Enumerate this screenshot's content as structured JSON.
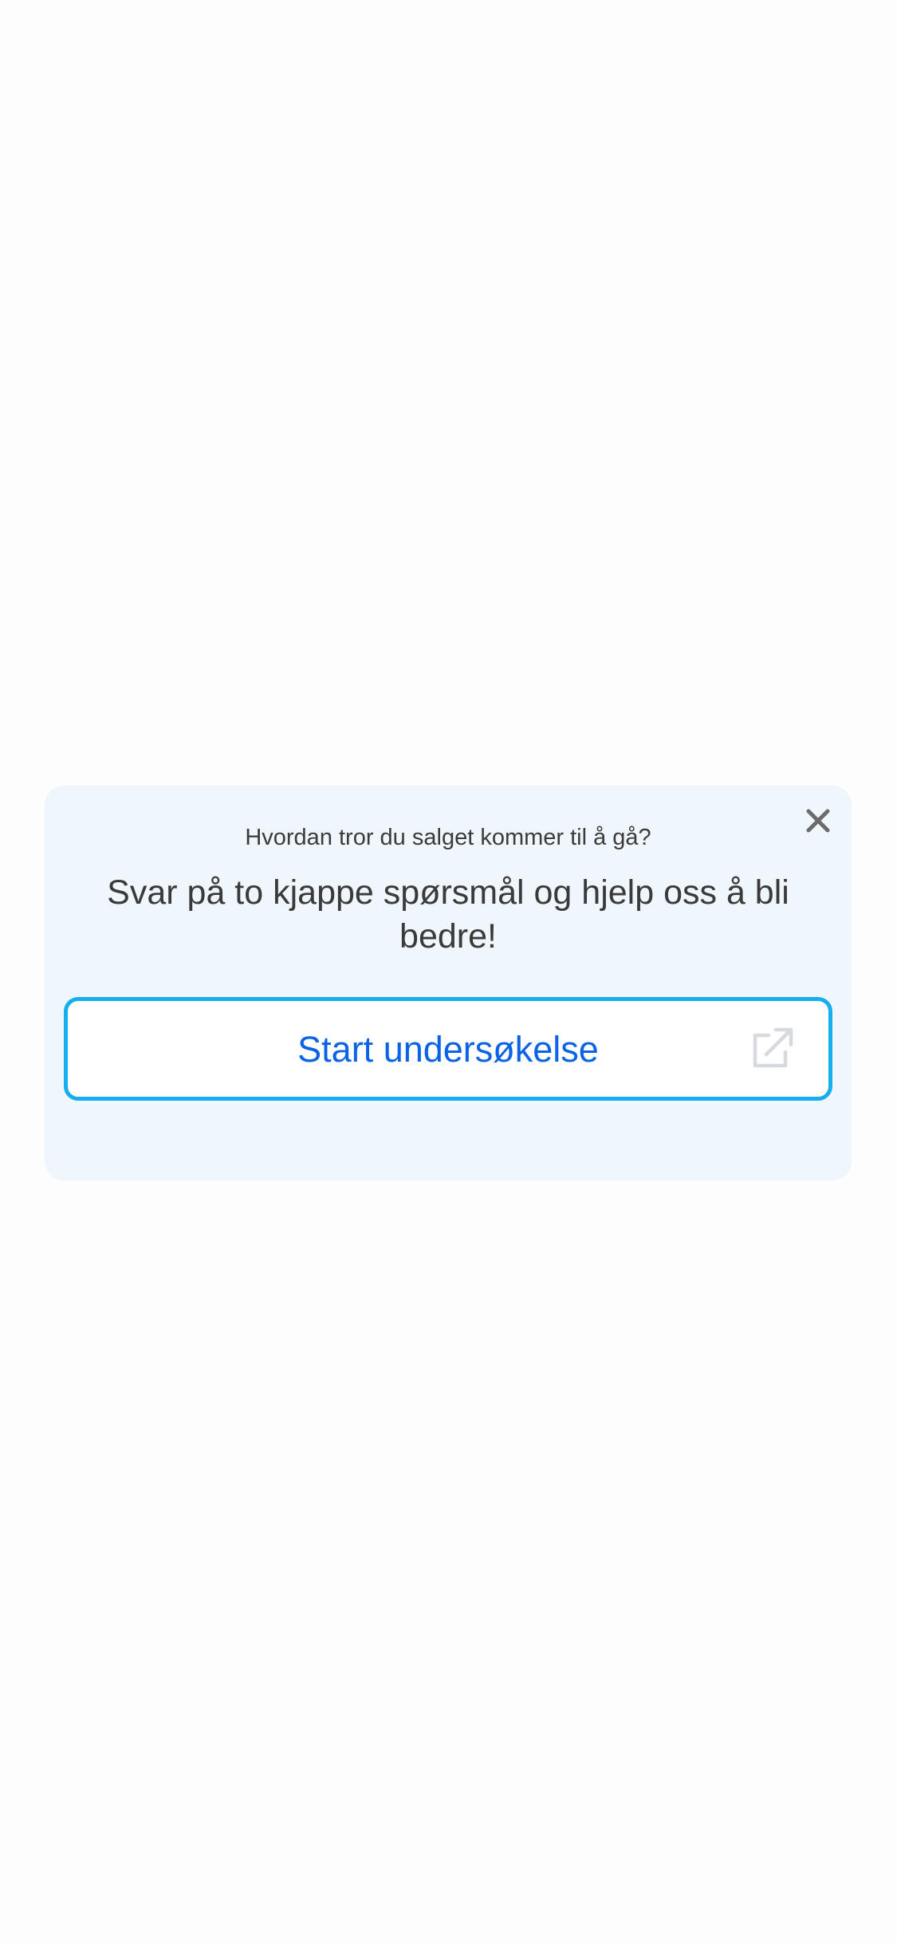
{
  "survey": {
    "question": "Hvordan tror du salget kommer til å gå?",
    "headline": "Svar på to kjappe spørsmål og hjelp oss å bli bedre!",
    "start_label": "Start undersøkelse",
    "close_icon": "close-icon",
    "external_icon": "external-link-icon"
  },
  "colors": {
    "page_background": "#fdfdfd",
    "card_background": "#eff6fc",
    "button_border": "#17aef0",
    "button_text": "#0a63e6",
    "text_dark": "#3a3a3a",
    "icon_gray": "#d6d9dd",
    "close_gray": "#6b6b6b"
  }
}
